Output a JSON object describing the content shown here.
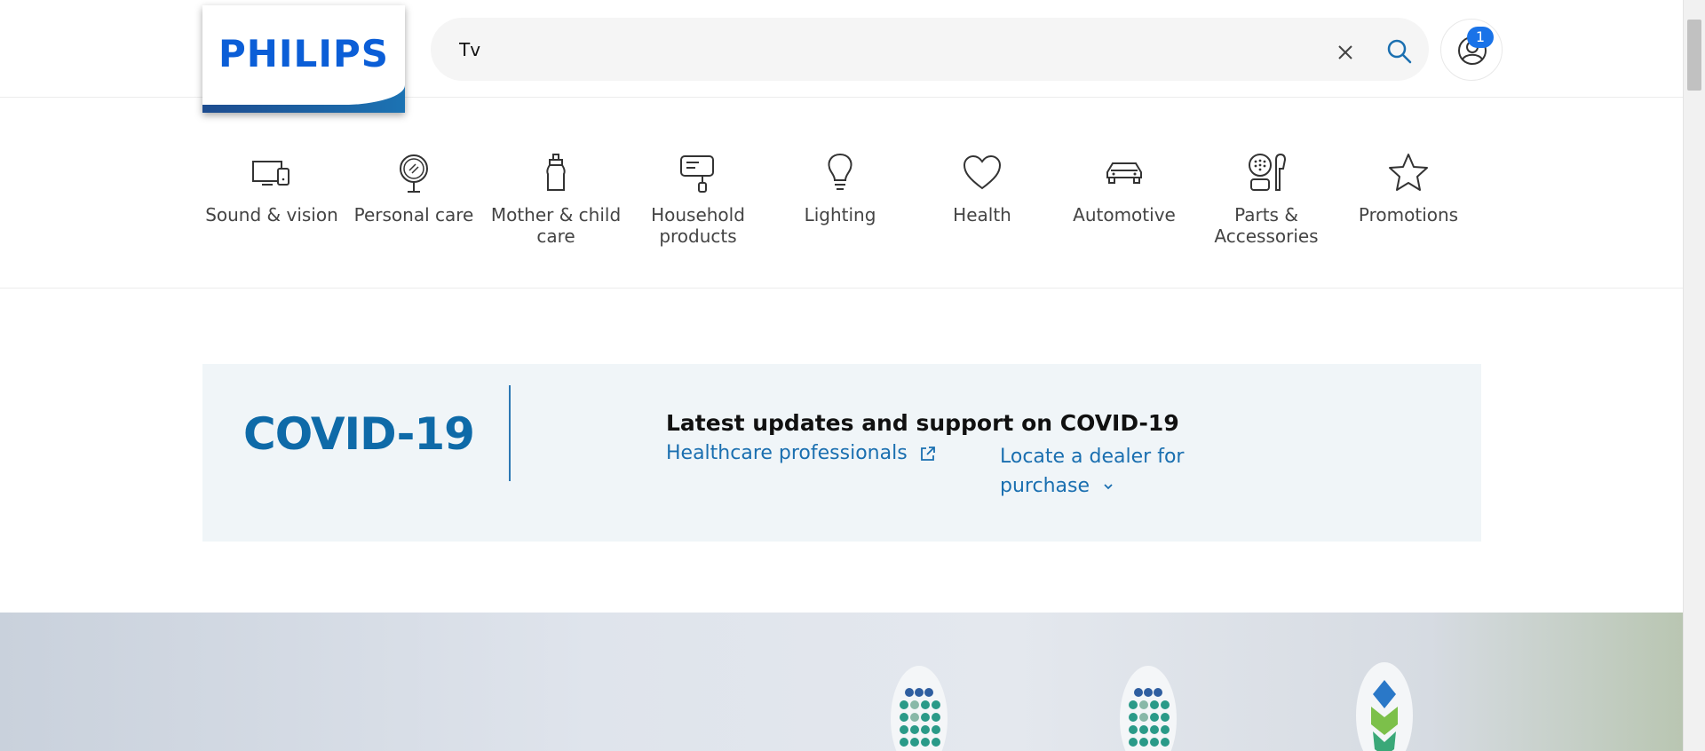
{
  "brand": {
    "logo_text": "PHILIPS",
    "color": "#0b5ed7"
  },
  "search": {
    "value": "Tv",
    "placeholder": ""
  },
  "account": {
    "badge_count": "1"
  },
  "categories": [
    {
      "label": "Sound & vision",
      "icon": "tv-phone-icon"
    },
    {
      "label": "Personal care",
      "icon": "mirror-icon"
    },
    {
      "label": "Mother & child care",
      "icon": "baby-bottle-icon"
    },
    {
      "label": "Household products",
      "icon": "mixer-icon"
    },
    {
      "label": "Lighting",
      "icon": "lightbulb-icon"
    },
    {
      "label": "Health",
      "icon": "heart-icon"
    },
    {
      "label": "Automotive",
      "icon": "car-icon"
    },
    {
      "label": "Parts & Accessories",
      "icon": "parts-icon"
    },
    {
      "label": "Promotions",
      "icon": "star-icon"
    }
  ],
  "covid": {
    "title": "COVID-19",
    "heading": "Latest updates and support on COVID-19",
    "link_healthcare": "Healthcare professionals",
    "link_dealer": "Locate a dealer for purchase"
  },
  "colors": {
    "accent": "#1a6fb0",
    "banner_bg": "#f0f5f8",
    "badge": "#1a73e8"
  }
}
